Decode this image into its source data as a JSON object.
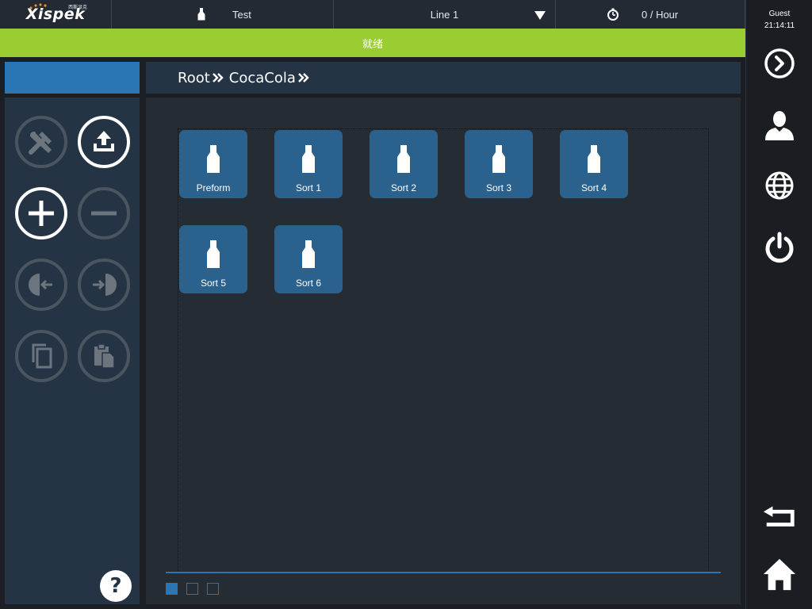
{
  "header": {
    "logo_text": "Xispek",
    "logo_sub": "西斯派克",
    "product_label": "Test",
    "line_label": "Line 1",
    "rate_label": "0 / Hour"
  },
  "status": {
    "text": "就绪"
  },
  "user": {
    "name": "Guest",
    "time": "21:14:11"
  },
  "breadcrumb": {
    "items": [
      "Root",
      "CocaCola"
    ]
  },
  "tiles": [
    {
      "label": "Preform"
    },
    {
      "label": "Sort 1"
    },
    {
      "label": "Sort 2"
    },
    {
      "label": "Sort 3"
    },
    {
      "label": "Sort 4"
    },
    {
      "label": "Sort 5"
    },
    {
      "label": "Sort 6"
    }
  ],
  "tools": [
    {
      "icon": "tools-icon",
      "enabled": false
    },
    {
      "icon": "upload-icon",
      "enabled": true
    },
    {
      "icon": "add-icon",
      "enabled": true
    },
    {
      "icon": "remove-icon",
      "enabled": false
    },
    {
      "icon": "move-left-icon",
      "enabled": false
    },
    {
      "icon": "move-right-icon",
      "enabled": false
    },
    {
      "icon": "copy-icon",
      "enabled": false
    },
    {
      "icon": "paste-icon",
      "enabled": false
    }
  ],
  "help": {
    "label": "?"
  },
  "pagination": {
    "pages": 3,
    "current": 1
  },
  "colors": {
    "accent": "#2a75b3",
    "status_ok": "#9acd32",
    "tile": "#2a618d",
    "panel": "#243444"
  }
}
